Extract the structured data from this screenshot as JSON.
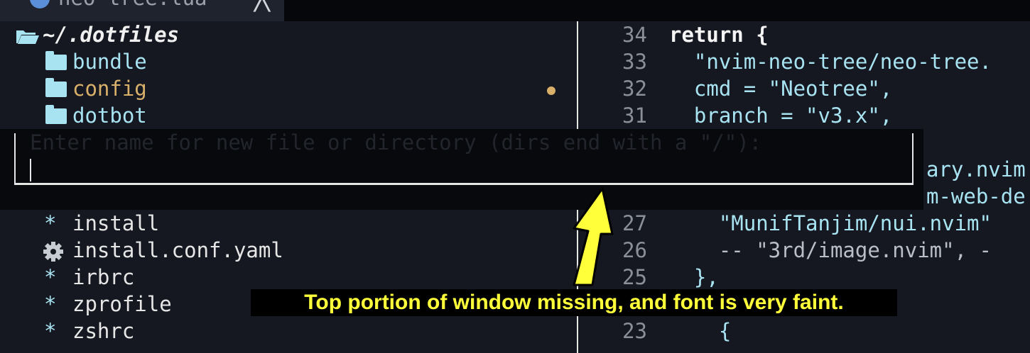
{
  "tab": {
    "label": "neo-tree.lua",
    "close_glyph": "╳",
    "icon": "lua-file-icon"
  },
  "tree": {
    "root": "~/.dotfiles",
    "dirs": [
      {
        "name": "bundle"
      },
      {
        "name": "config",
        "modified": true
      },
      {
        "name": "dotbot"
      }
    ],
    "files": [
      {
        "icon": "*",
        "name": "install"
      },
      {
        "icon": "gear",
        "name": "install.conf.yaml"
      },
      {
        "icon": "*",
        "name": "irbrc"
      },
      {
        "icon": "*",
        "name": "zprofile"
      },
      {
        "icon": "*",
        "name": "zshrc"
      }
    ]
  },
  "popup": {
    "prompt": "Enter name for new file or directory (dirs end with a \"/\"):",
    "value": ""
  },
  "code": {
    "lines": [
      {
        "num": "34",
        "text": "return {"
      },
      {
        "num": "33",
        "text": "  \"nvim-neo-tree/neo-tree."
      },
      {
        "num": "32",
        "text": "  cmd = \"Neotree\","
      },
      {
        "num": "31",
        "text": "  branch = \"v3.x\","
      },
      {
        "num": "",
        "text": "ary.nvim"
      },
      {
        "num": "",
        "text": "m-web-de"
      },
      {
        "num": "27",
        "text": "    \"MunifTanjim/nui.nvim\""
      },
      {
        "num": "26",
        "text": "    -- \"3rd/image.nvim\", -"
      },
      {
        "num": "25",
        "text": "  },"
      },
      {
        "num": "23",
        "text": "    {"
      }
    ]
  },
  "annotation": {
    "text": "Top portion of window missing, and font is very faint.",
    "color": "#ffff3a"
  }
}
